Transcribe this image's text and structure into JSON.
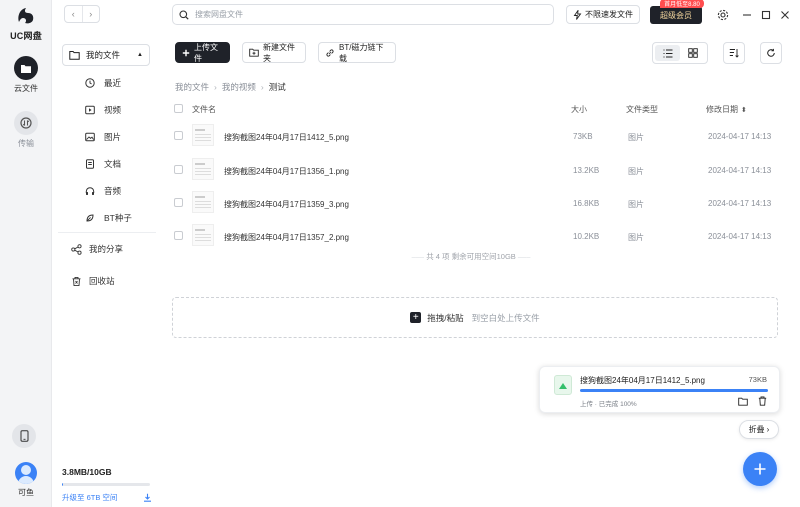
{
  "app": {
    "logo_text": "UC网盘"
  },
  "rail": {
    "cloud_label": "云文件",
    "transfer_label": "传输",
    "user_label": "可鱼"
  },
  "topbar": {
    "search_placeholder": "搜索网盘文件",
    "speed_label": "不限速发文件",
    "vip_label": "超级会员",
    "vip_badge": "首月低至8.80"
  },
  "sidebar": {
    "my_files": "我的文件",
    "items": [
      {
        "label": "最近",
        "icon": "clock-icon"
      },
      {
        "label": "视频",
        "icon": "video-icon"
      },
      {
        "label": "图片",
        "icon": "image-icon"
      },
      {
        "label": "文档",
        "icon": "document-icon"
      },
      {
        "label": "音频",
        "icon": "headphones-icon"
      },
      {
        "label": "BT种子",
        "icon": "seed-icon"
      }
    ],
    "share": "我的分享",
    "recycle": "回收站",
    "storage": {
      "value": "3.8MB/10GB",
      "used_fraction": 0.00037,
      "upgrade": "升级至 6TB 空间"
    }
  },
  "toolbar": {
    "upload": "上传文件",
    "new_folder": "新建文件夹",
    "bt": "BT/磁力链下载"
  },
  "breadcrumb": [
    "我的文件",
    "我的视频",
    "测试"
  ],
  "table": {
    "headers": {
      "name": "文件名",
      "size": "大小",
      "type": "文件类型",
      "date": "修改日期"
    },
    "rows": [
      {
        "name": "搜狗截图24年04月17日1412_5.png",
        "size": "73KB",
        "type": "图片",
        "date": "2024-04-17 14:13"
      },
      {
        "name": "搜狗截图24年04月17日1356_1.png",
        "size": "13.2KB",
        "type": "图片",
        "date": "2024-04-17 14:13"
      },
      {
        "name": "搜狗截图24年04月17日1359_3.png",
        "size": "16.8KB",
        "type": "图片",
        "date": "2024-04-17 14:13"
      },
      {
        "name": "搜狗截图24年04月17日1357_2.png",
        "size": "10.2KB",
        "type": "图片",
        "date": "2024-04-17 14:13"
      }
    ],
    "summary": "共 4 项 剩余可用空间10GB"
  },
  "dropzone": {
    "label": "拖拽/粘贴",
    "hint": "到空白处上传文件"
  },
  "upload_card": {
    "file_name": "搜狗截图24年04月17日1412_5.png",
    "file_size": "73KB",
    "status": "上传 · 已完成 100%",
    "progress": 1.0
  },
  "fold_label": "折叠"
}
